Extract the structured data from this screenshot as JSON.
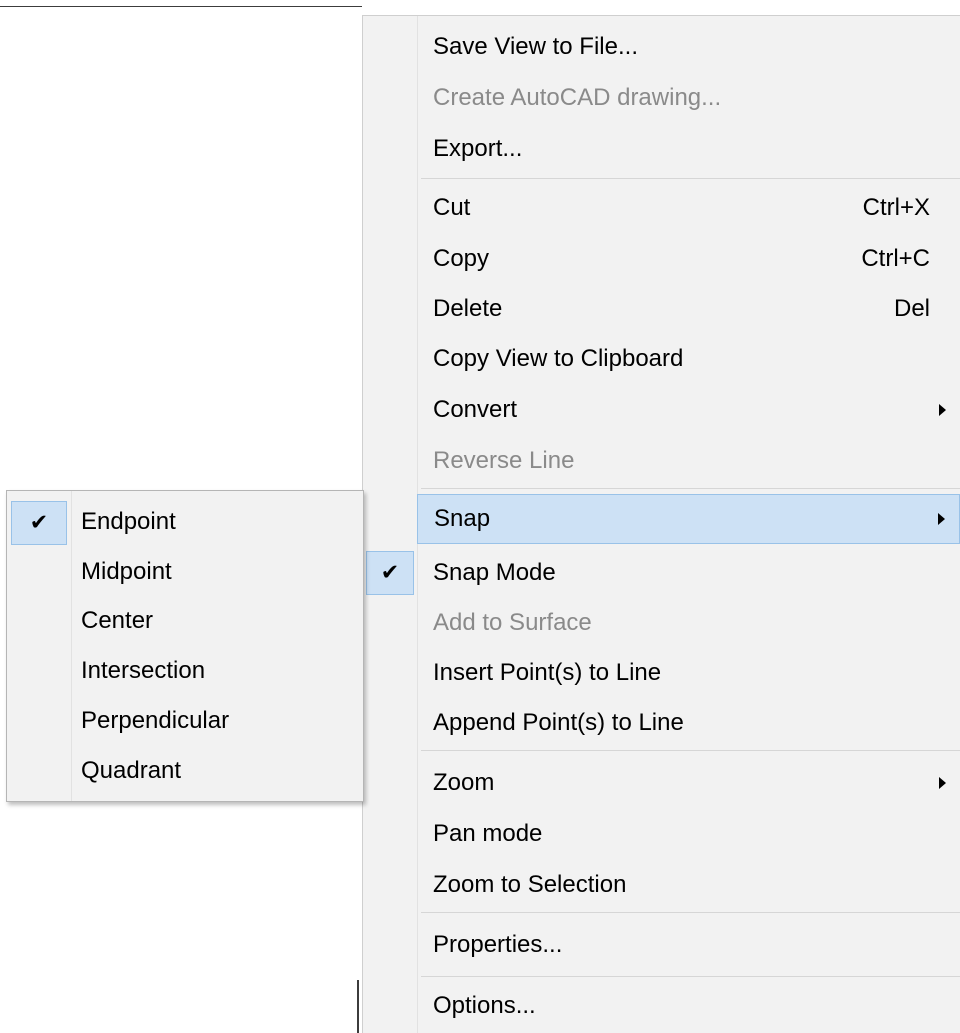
{
  "context_menu": {
    "items": [
      {
        "label": "Save View to File...",
        "enabled": true
      },
      {
        "label": "Create AutoCAD drawing...",
        "enabled": false
      },
      {
        "label": "Export...",
        "enabled": true
      },
      {
        "label": "Cut",
        "shortcut": "Ctrl+X",
        "enabled": true
      },
      {
        "label": "Copy",
        "shortcut": "Ctrl+C",
        "enabled": true
      },
      {
        "label": "Delete",
        "shortcut": "Del",
        "enabled": true
      },
      {
        "label": "Copy View to Clipboard",
        "enabled": true
      },
      {
        "label": "Convert",
        "submenu": true,
        "enabled": true
      },
      {
        "label": "Reverse Line",
        "enabled": false
      },
      {
        "label": "Snap",
        "submenu": true,
        "highlighted": true,
        "enabled": true
      },
      {
        "label": "Snap Mode",
        "checked": true,
        "enabled": true
      },
      {
        "label": "Add to Surface",
        "enabled": false
      },
      {
        "label": "Insert Point(s) to Line",
        "enabled": true
      },
      {
        "label": "Append Point(s) to Line",
        "enabled": true
      },
      {
        "label": "Zoom",
        "submenu": true,
        "enabled": true
      },
      {
        "label": "Pan mode",
        "enabled": true
      },
      {
        "label": "Zoom to Selection",
        "enabled": true
      },
      {
        "label": "Properties...",
        "enabled": true
      },
      {
        "label": "Options...",
        "enabled": true
      }
    ],
    "check_glyph": "✔"
  },
  "snap_submenu": {
    "items": [
      {
        "label": "Endpoint",
        "checked": true
      },
      {
        "label": "Midpoint",
        "checked": false
      },
      {
        "label": "Center",
        "checked": false
      },
      {
        "label": "Intersection",
        "checked": false
      },
      {
        "label": "Perpendicular",
        "checked": false
      },
      {
        "label": "Quadrant",
        "checked": false
      }
    ]
  },
  "colors": {
    "menu_bg": "#f2f2f2",
    "highlight_bg": "#cde1f5",
    "highlight_border": "#99c2e8",
    "disabled_text": "#8a8a8a"
  }
}
